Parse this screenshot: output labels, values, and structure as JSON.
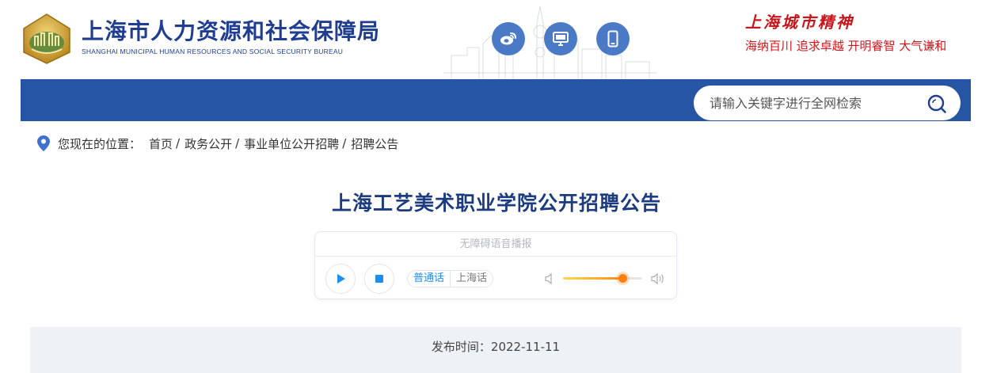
{
  "header": {
    "title_zh": "上海市人力资源和社会保障局",
    "title_en": "SHANGHAI MUNICIPAL HUMAN RESOURCES AND SOCIAL SECURITY BUREAU",
    "icons": [
      "weibo-icon",
      "desktop-icon",
      "mobile-icon"
    ],
    "spirit_title": "上海城市精神",
    "spirit_slogan": "海纳百川  追求卓越  开明睿智  大气谦和"
  },
  "search": {
    "placeholder": "请输入关键字进行全网检索"
  },
  "breadcrumb": {
    "label": "您现在的位置：",
    "items": [
      "首页",
      "政务公开",
      "事业单位公开招聘",
      "招聘公告"
    ],
    "separator": "/"
  },
  "article": {
    "title": "上海工艺美术职业学院公开招聘公告",
    "publish": "发布时间：2022-11-11"
  },
  "player": {
    "title": "无障碍语音播报",
    "languages": [
      "普通话",
      "上海话"
    ],
    "active_language": "普通话",
    "volume_percent": 75
  },
  "colors": {
    "brand_blue": "#2555a3",
    "title_blue": "#1d3c80",
    "slogan_red": "#d5141a",
    "icon_circle": "#4a79c6"
  }
}
